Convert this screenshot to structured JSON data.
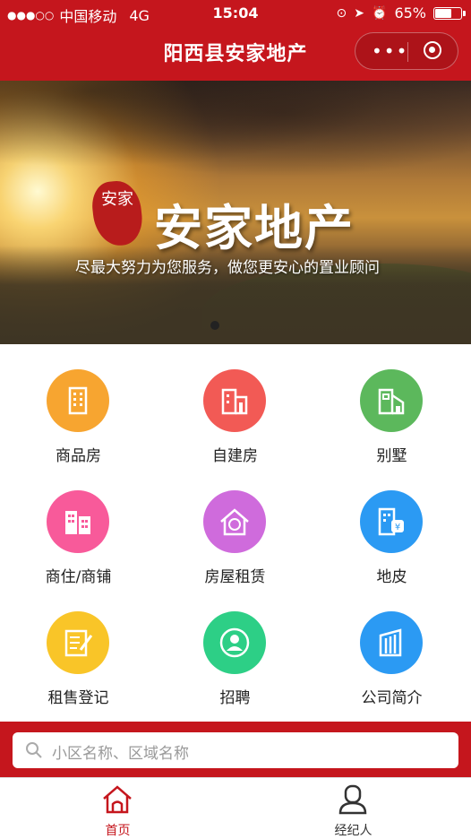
{
  "status_bar": {
    "carrier": "中国移动",
    "network": "4G",
    "time": "15:04",
    "battery": "65%",
    "battery_level": 0.65
  },
  "nav": {
    "title": "阳西县安家地产",
    "more_icon": "more-dots-icon",
    "close_icon": "target-circle-icon"
  },
  "banner": {
    "seal_text": "安家",
    "brand": "安家地产",
    "slogan": "尽最大努力为您服务，做您更安心的置业顾问"
  },
  "menu": [
    {
      "label": "商品房",
      "color": "#f7a530",
      "icon": "building-icon"
    },
    {
      "label": "自建房",
      "color": "#f25a55",
      "icon": "house-icon"
    },
    {
      "label": "别墅",
      "color": "#5cb85c",
      "icon": "villa-icon"
    },
    {
      "label": "商住/商铺",
      "color": "#f85a9a",
      "icon": "shops-icon"
    },
    {
      "label": "房屋租赁",
      "color": "#cf6bdc",
      "icon": "rent-house-icon"
    },
    {
      "label": "地皮",
      "color": "#2b9af3",
      "icon": "land-icon"
    },
    {
      "label": "租售登记",
      "color": "#f9c528",
      "icon": "register-icon"
    },
    {
      "label": "招聘",
      "color": "#2dcf86",
      "icon": "recruit-icon"
    },
    {
      "label": "公司简介",
      "color": "#2b9af3",
      "icon": "company-icon"
    }
  ],
  "search": {
    "placeholder": "小区名称、区域名称"
  },
  "tabs": [
    {
      "label": "首页",
      "icon": "home-icon",
      "active": true
    },
    {
      "label": "经纪人",
      "icon": "agent-icon",
      "active": false
    }
  ],
  "colors": {
    "brand_red": "#c5161d",
    "tab_inactive": "#333333"
  }
}
